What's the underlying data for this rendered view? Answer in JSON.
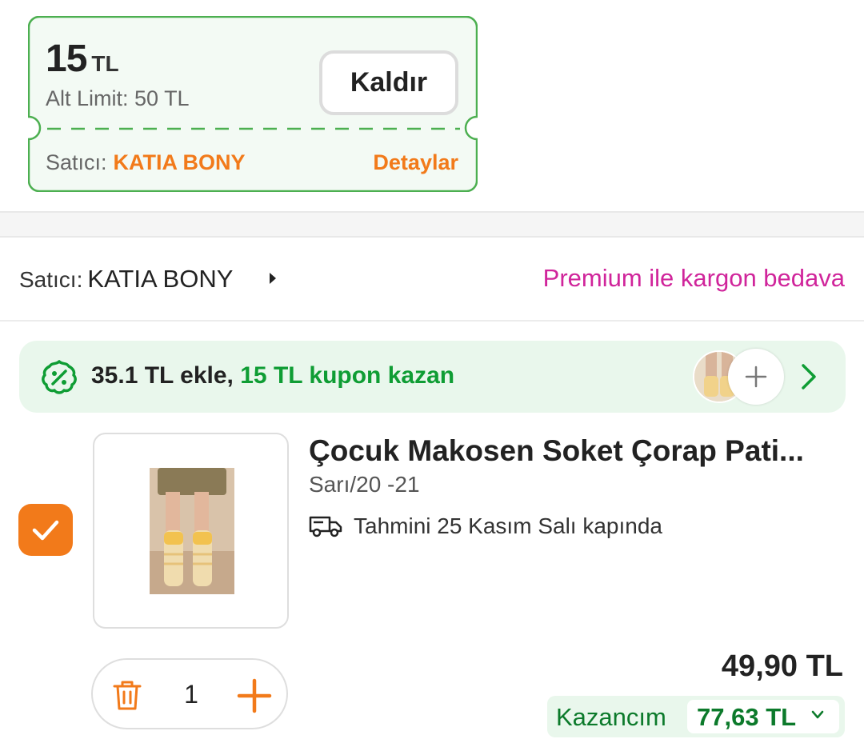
{
  "coupon": {
    "amount": "15",
    "currency": "TL",
    "min_limit": "Alt Limit: 50 TL",
    "remove_label": "Kaldır",
    "seller_label": "Satıcı:",
    "seller_name": "KATIA BONY",
    "details_label": "Detaylar",
    "border_color": "#4caf50"
  },
  "seller": {
    "label": "Satıcı:",
    "name": "KATIA BONY",
    "premium_text": "Premium ile kargon bedava"
  },
  "promo": {
    "text_prefix": "35.1 TL ekle,",
    "text_highlight": "15 TL kupon kazan",
    "icon": "coupon-leaf-icon"
  },
  "product": {
    "checked": true,
    "title": "Çocuk Makosen Soket Çorap Pati...",
    "variant": "Sarı/20 -21",
    "delivery": "Tahmini 25 Kasım Salı kapında",
    "quantity": "1",
    "price": "49,90 TL",
    "earnings_label": "Kazancım",
    "earnings_value": "77,63 TL"
  },
  "colors": {
    "accent": "#f27a1a",
    "green": "#0f9d34",
    "premium": "#d0259b"
  }
}
